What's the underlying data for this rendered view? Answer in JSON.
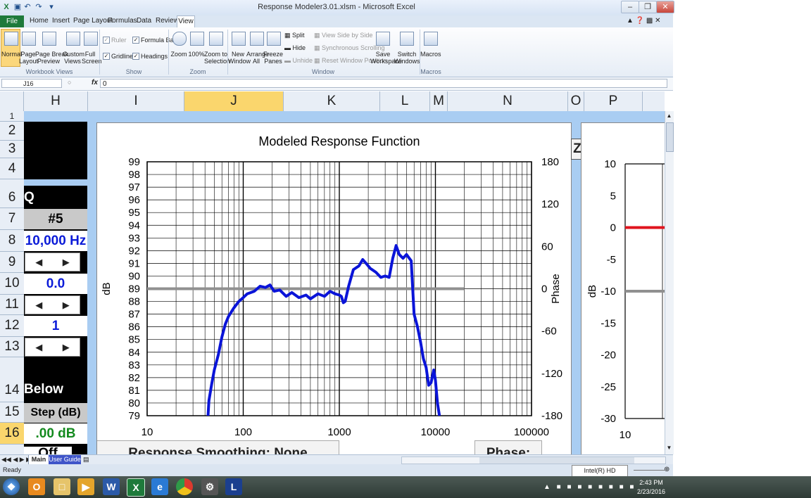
{
  "window": {
    "title": "Response Modeler3.01.xlsm - Microsoft Excel"
  },
  "ribbon_tabs": [
    "Home",
    "Insert",
    "Page Layout",
    "Formulas",
    "Data",
    "Review"
  ],
  "file_tab": "File",
  "active_tab": "View",
  "ribbon": {
    "normal": "Normal",
    "page_layout": "Page\nLayout",
    "page_break": "Page Break\nPreview",
    "custom_views": "Custom\nViews",
    "full_screen": "Full\nScreen",
    "ruler": "Ruler",
    "gridlines": "Gridlines",
    "formula_bar": "Formula Bar",
    "headings": "Headings",
    "zoom": "Zoom",
    "zoom100": "100%",
    "zoom_sel": "Zoom to\nSelection",
    "new_window": "New\nWindow",
    "arrange_all": "Arrange\nAll",
    "freeze_panes": "Freeze\nPanes",
    "split": "Split",
    "hide": "Hide",
    "unhide": "Unhide",
    "side_by_side": "View Side by Side",
    "sync_scroll": "Synchronous Scrolling",
    "reset_pos": "Reset Window Position",
    "save_ws": "Save\nWorkspace",
    "switch_win": "Switch\nWindows",
    "macros": "Macros",
    "groups": {
      "workbook_views": "Workbook Views",
      "show": "Show",
      "zoom": "Zoom",
      "window": "Window",
      "macros": "Macros"
    }
  },
  "formula_bar": {
    "name_box": "J16",
    "fx": "fx",
    "value": "0"
  },
  "columns": [
    "H",
    "I",
    "J",
    "K",
    "L",
    "M",
    "N",
    "O",
    "P"
  ],
  "rows": [
    "1",
    "2",
    "3",
    "4",
    "6",
    "7",
    "8",
    "9",
    "10",
    "11",
    "12",
    "13",
    "14",
    "15",
    "16"
  ],
  "left_panel": {
    "q_label": "Q",
    "band": "#5",
    "freq": "10,000 Hz",
    "gain": "0.0",
    "q_value": "1",
    "below_label": "Below",
    "step_label": "Step (dB)",
    "step_value": ".00 dB",
    "off_label": "Off"
  },
  "zoom_button": "Zoom",
  "bottom_labels": {
    "smoothing": "Response  Smoothing:  None",
    "phase": "Phase:"
  },
  "chart_data": {
    "type": "line",
    "title": "Modeled Response Function",
    "xlabel": "",
    "ylabel": "dB",
    "y2label": "Phase",
    "xscale": "log",
    "xlim": [
      10,
      100000
    ],
    "ylim": [
      79,
      99
    ],
    "y2lim": [
      -180,
      180
    ],
    "x_ticks": [
      "10",
      "100",
      "1000",
      "10000",
      "100000"
    ],
    "y_ticks": [
      "79",
      "80",
      "81",
      "82",
      "83",
      "84",
      "85",
      "86",
      "87",
      "88",
      "89",
      "90",
      "91",
      "92",
      "93",
      "94",
      "95",
      "96",
      "97",
      "98",
      "99"
    ],
    "y2_ticks": [
      "-180",
      "-120",
      "-60",
      "0",
      "60",
      "120",
      "180"
    ],
    "grid": true,
    "series": [
      {
        "color": "#0a14d8",
        "points": [
          [
            43,
            79
          ],
          [
            44,
            80.2
          ],
          [
            47,
            81.5
          ],
          [
            50,
            82.6
          ],
          [
            55,
            83.8
          ],
          [
            60,
            85.2
          ],
          [
            65,
            86.2
          ],
          [
            70,
            86.8
          ],
          [
            80,
            87.5
          ],
          [
            90,
            88.0
          ],
          [
            100,
            88.3
          ],
          [
            110,
            88.6
          ],
          [
            130,
            88.8
          ],
          [
            150,
            89.2
          ],
          [
            170,
            89.1
          ],
          [
            190,
            89.3
          ],
          [
            210,
            88.8
          ],
          [
            240,
            88.9
          ],
          [
            280,
            88.4
          ],
          [
            320,
            88.7
          ],
          [
            380,
            88.3
          ],
          [
            450,
            88.5
          ],
          [
            500,
            88.2
          ],
          [
            600,
            88.6
          ],
          [
            700,
            88.4
          ],
          [
            800,
            88.8
          ],
          [
            900,
            88.6
          ],
          [
            1000,
            88.5
          ],
          [
            1050,
            88.4
          ],
          [
            1100,
            87.9
          ],
          [
            1150,
            88.0
          ],
          [
            1250,
            89.2
          ],
          [
            1400,
            90.5
          ],
          [
            1600,
            90.8
          ],
          [
            1750,
            91.3
          ],
          [
            1900,
            91.0
          ],
          [
            2100,
            90.6
          ],
          [
            2400,
            90.3
          ],
          [
            2700,
            89.9
          ],
          [
            3000,
            90.0
          ],
          [
            3300,
            89.9
          ],
          [
            3600,
            91.4
          ],
          [
            3900,
            92.4
          ],
          [
            4200,
            91.7
          ],
          [
            4600,
            91.4
          ],
          [
            5000,
            91.7
          ],
          [
            5600,
            91.2
          ],
          [
            6000,
            87.0
          ],
          [
            6500,
            86.0
          ],
          [
            7000,
            84.8
          ],
          [
            7500,
            83.5
          ],
          [
            8000,
            82.8
          ],
          [
            8500,
            81.4
          ],
          [
            9000,
            81.6
          ],
          [
            9600,
            82.6
          ],
          [
            10000,
            81.8
          ],
          [
            10500,
            80.0
          ],
          [
            11000,
            79.0
          ]
        ]
      },
      {
        "color": "#909090",
        "points": [
          [
            10,
            89
          ],
          [
            20000,
            89
          ]
        ]
      }
    ]
  },
  "chart2_data": {
    "type": "line",
    "title": "",
    "xlabel": "",
    "ylabel": "dB",
    "xscale": "log",
    "xlim": [
      10,
      100000
    ],
    "ylim": [
      -30,
      10
    ],
    "x_ticks": [
      "10"
    ],
    "y_ticks": [
      "10",
      "5",
      "0",
      "-5",
      "-10",
      "-15",
      "-20",
      "-25",
      "-30"
    ],
    "series": [
      {
        "color": "#e0141e",
        "points": [
          [
            10,
            0
          ],
          [
            100000,
            0
          ]
        ]
      },
      {
        "color": "#909090",
        "points": [
          [
            10,
            -10
          ],
          [
            100000,
            -10
          ]
        ]
      }
    ]
  },
  "sheet_tabs": [
    "Main",
    "User Guide"
  ],
  "status": {
    "ready": "Ready",
    "tooltip": "Intel(R) HD Graphics"
  },
  "taskbar": {
    "time": "2:43 PM",
    "date": "2/23/2016"
  }
}
